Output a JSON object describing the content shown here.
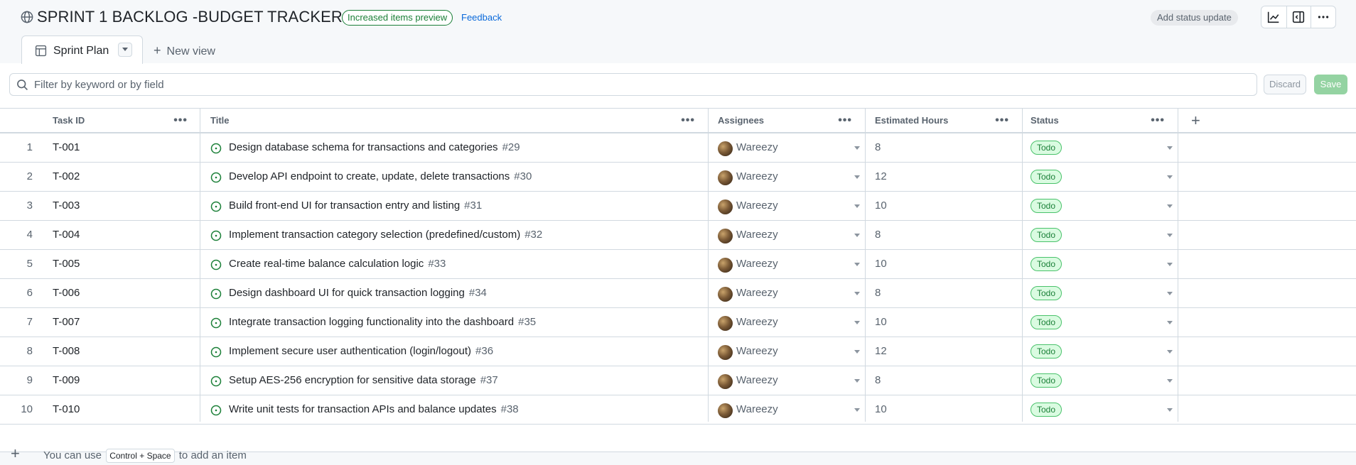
{
  "header": {
    "title": "SPRINT 1 BACKLOG -BUDGET TRACKER",
    "preview_pill": "Increased items preview",
    "feedback": "Feedback",
    "status_update": "Add status update"
  },
  "tabs": {
    "active_label": "Sprint Plan",
    "new_view": "New view"
  },
  "filter": {
    "placeholder": "Filter by keyword or by field",
    "discard": "Discard",
    "save": "Save"
  },
  "table": {
    "columns": [
      "Task ID",
      "Title",
      "Assignees",
      "Estimated Hours",
      "Status"
    ],
    "rows": [
      {
        "n": "1",
        "id": "T-001",
        "title": "Design database schema for transactions and categories",
        "issue": "#29",
        "assignee": "Wareezy",
        "hours": "8",
        "status": "Todo"
      },
      {
        "n": "2",
        "id": "T-002",
        "title": "Develop API endpoint to create, update, delete transactions",
        "issue": "#30",
        "assignee": "Wareezy",
        "hours": "12",
        "status": "Todo"
      },
      {
        "n": "3",
        "id": "T-003",
        "title": "Build front-end UI for transaction entry and listing",
        "issue": "#31",
        "assignee": "Wareezy",
        "hours": "10",
        "status": "Todo"
      },
      {
        "n": "4",
        "id": "T-004",
        "title": "Implement transaction category selection (predefined/custom)",
        "issue": "#32",
        "assignee": "Wareezy",
        "hours": "8",
        "status": "Todo"
      },
      {
        "n": "5",
        "id": "T-005",
        "title": "Create real-time balance calculation logic",
        "issue": "#33",
        "assignee": "Wareezy",
        "hours": "10",
        "status": "Todo"
      },
      {
        "n": "6",
        "id": "T-006",
        "title": "Design dashboard UI for quick transaction logging",
        "issue": "#34",
        "assignee": "Wareezy",
        "hours": "8",
        "status": "Todo"
      },
      {
        "n": "7",
        "id": "T-007",
        "title": "Integrate transaction logging functionality into the dashboard",
        "issue": "#35",
        "assignee": "Wareezy",
        "hours": "10",
        "status": "Todo"
      },
      {
        "n": "8",
        "id": "T-008",
        "title": "Implement secure user authentication (login/logout)",
        "issue": "#36",
        "assignee": "Wareezy",
        "hours": "12",
        "status": "Todo"
      },
      {
        "n": "9",
        "id": "T-009",
        "title": "Setup AES-256 encryption for sensitive data storage",
        "issue": "#37",
        "assignee": "Wareezy",
        "hours": "8",
        "status": "Todo"
      },
      {
        "n": "10",
        "id": "T-010",
        "title": "Write unit tests for transaction APIs and balance updates",
        "issue": "#38",
        "assignee": "Wareezy",
        "hours": "10",
        "status": "Todo"
      }
    ]
  },
  "footer": {
    "hint_prefix": "You can use",
    "hint_key": "Control + Space",
    "hint_suffix": "to add an item"
  },
  "colors": {
    "open_issue": "#1a7f37",
    "todo_bg": "#dafbe1",
    "link": "#0969da"
  }
}
